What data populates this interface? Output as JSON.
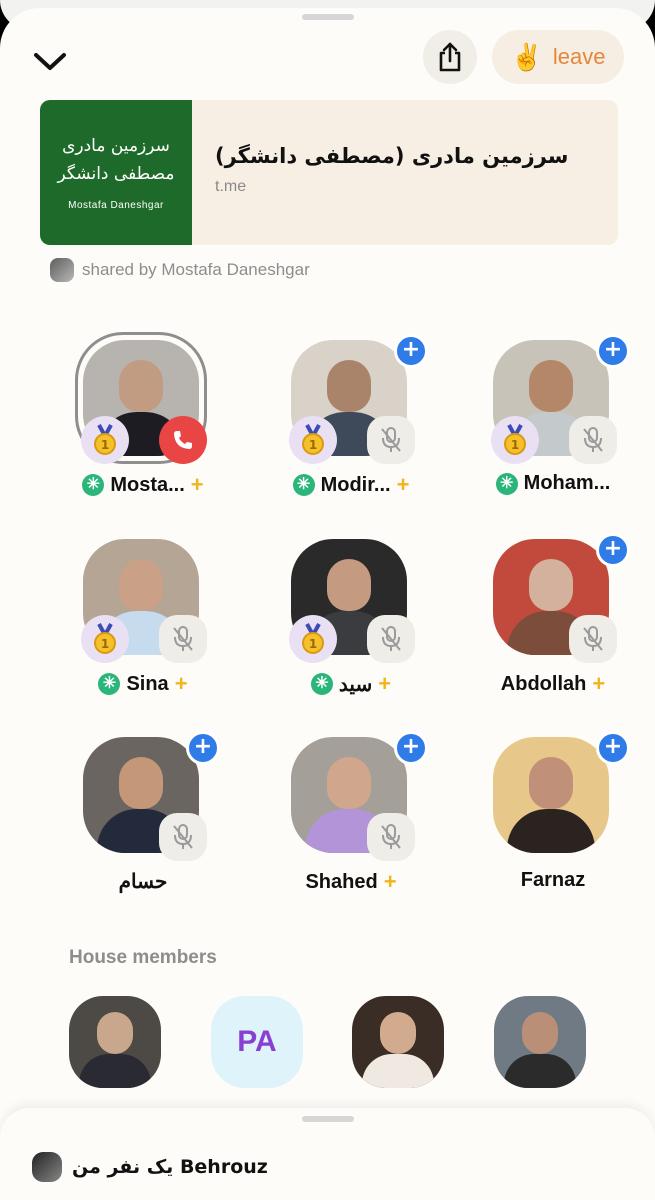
{
  "header": {
    "leave_label": "leave",
    "leave_emoji": "✌️"
  },
  "link_card": {
    "thumb_line1": "سرزمین مادری",
    "thumb_line2": "مصطفی دانشگر",
    "thumb_line3": "Mostafa Daneshgar",
    "title": "سرزمین مادری (مصطفی دانشگر)",
    "domain": "t.me",
    "shared_by": "shared by Mostafa Daneshgar"
  },
  "speakers": [
    {
      "name": "Mosta...",
      "star": true,
      "plus": true,
      "medal": true,
      "status": "hangup",
      "follow": false
    },
    {
      "name": "Modir...",
      "star": true,
      "plus": true,
      "medal": true,
      "status": "muted",
      "follow": true
    },
    {
      "name": "Moham...",
      "star": true,
      "plus": false,
      "medal": true,
      "status": "muted",
      "follow": true
    },
    {
      "name": "Sina",
      "star": true,
      "plus": true,
      "medal": true,
      "status": "muted",
      "follow": false
    },
    {
      "name": "سید",
      "star": true,
      "plus": true,
      "medal": true,
      "status": "muted",
      "follow": false
    },
    {
      "name": "Abdollah",
      "star": false,
      "plus": true,
      "medal": false,
      "status": "muted",
      "follow": true
    },
    {
      "name": "حسام",
      "star": false,
      "plus": false,
      "medal": false,
      "status": "muted",
      "follow": true
    },
    {
      "name": "Shahed",
      "star": false,
      "plus": true,
      "medal": false,
      "status": "muted",
      "follow": true
    },
    {
      "name": "Farnaz",
      "star": false,
      "plus": false,
      "medal": false,
      "status": "none",
      "follow": true
    }
  ],
  "house_members": {
    "title": "House members",
    "initials": "PA"
  },
  "bottom": {
    "text": "Behrouz یک نفر من"
  },
  "colors": {
    "accent_orange": "#e4873b",
    "follow_blue": "#2f7be8",
    "moderator_green": "#2bb57a",
    "plus_gold": "#f2b31d",
    "hangup_red": "#e94545"
  }
}
